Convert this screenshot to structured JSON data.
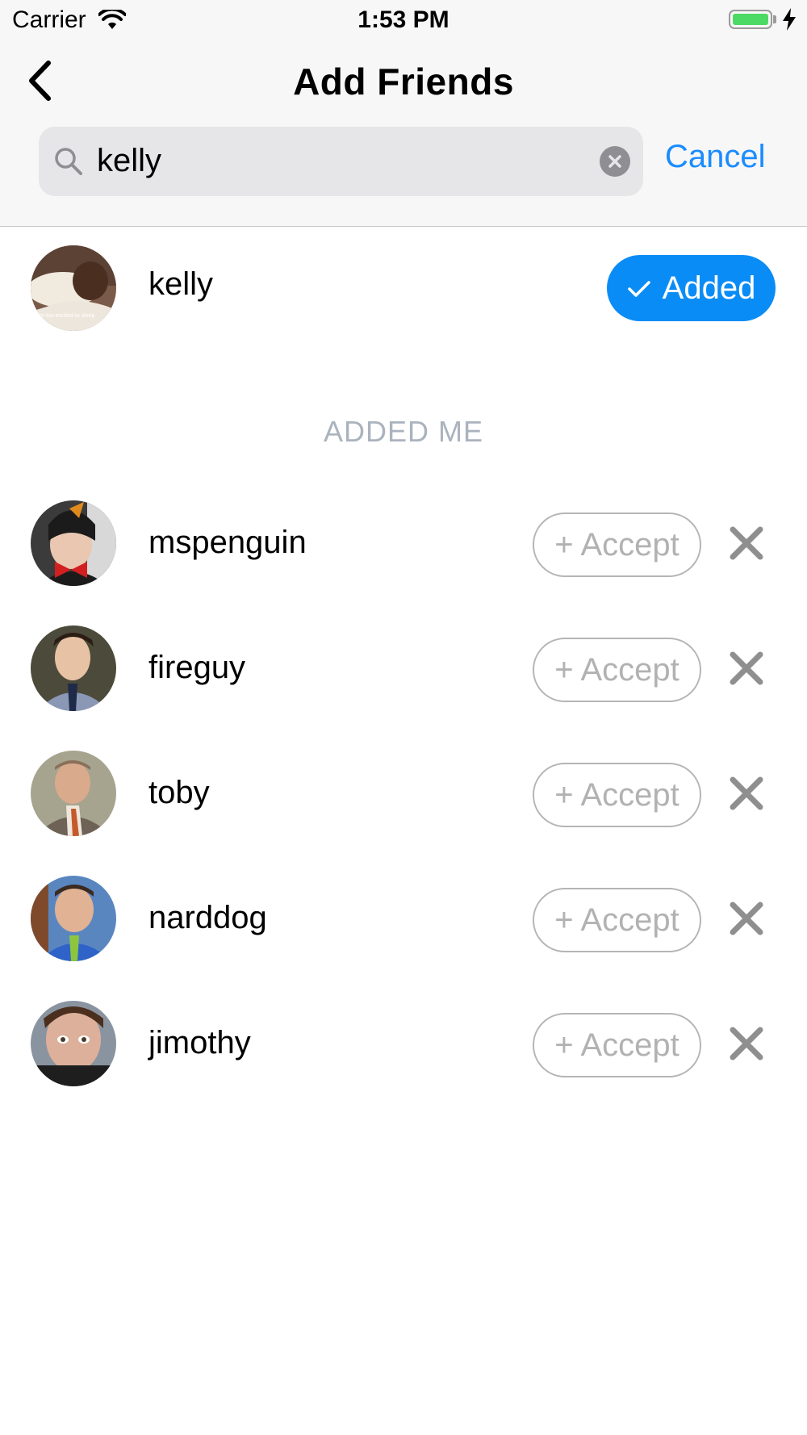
{
  "status_bar": {
    "carrier": "Carrier",
    "time": "1:53 PM"
  },
  "header": {
    "title": "Add Friends"
  },
  "search": {
    "value": "kelly",
    "cancel_label": "Cancel"
  },
  "search_results": [
    {
      "username": "kelly",
      "status_label": "Added",
      "avatar_caption": "I'm too excited to sleep"
    }
  ],
  "added_me": {
    "section_title": "ADDED ME",
    "accept_label": "+ Accept",
    "users": [
      {
        "username": "mspenguin"
      },
      {
        "username": "fireguy"
      },
      {
        "username": "toby"
      },
      {
        "username": "narddog"
      },
      {
        "username": "jimothy"
      }
    ]
  },
  "colors": {
    "accent": "#0a8cf6",
    "link": "#1a8cff",
    "muted": "#aab3be"
  },
  "icons": [
    "wifi-icon",
    "battery-icon",
    "charging-bolt-icon",
    "back-chevron-icon",
    "search-icon",
    "clear-icon",
    "checkmark-icon",
    "close-icon"
  ]
}
